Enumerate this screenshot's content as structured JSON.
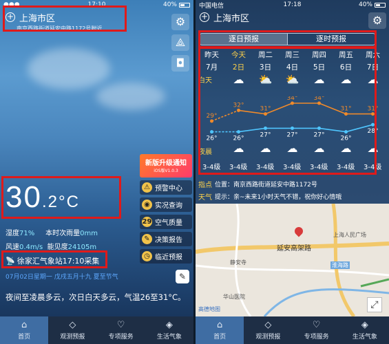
{
  "left": {
    "status": {
      "carrier": "●●●",
      "time": "17:10",
      "battery": "40%"
    },
    "location": {
      "plus_icon": "plus-circle-icon",
      "city": "上海市区",
      "address": "南京西路街道延安中路1172号附近"
    },
    "side_icons": [
      "gear-icon",
      "share-icon",
      "camera-icon"
    ],
    "temperature": {
      "int": "30",
      "decimal": ".2",
      "unit": "°C"
    },
    "banner": {
      "title": "新版升级通知",
      "version": "iOS版V1.0.3"
    },
    "menu": [
      {
        "icon": "warning-icon",
        "glyph": "⚠",
        "label": "预警中心"
      },
      {
        "icon": "live-icon",
        "glyph": "◉",
        "label": "实况查询"
      },
      {
        "icon": "aqi-icon",
        "glyph": "29",
        "label": "空气质量"
      },
      {
        "icon": "report-icon",
        "glyph": "✎",
        "label": "决策报告"
      },
      {
        "icon": "clock-icon",
        "glyph": "◷",
        "label": "临近预报"
      }
    ],
    "humidity_label": "湿度",
    "humidity": "71%",
    "rain_label": "本时次雨量",
    "rain": "0mm",
    "wind_label": "风速",
    "wind": "0.4m/s",
    "vis_label": "能见度",
    "vis": "24105m",
    "station": "徐家汇气象站17:10采集",
    "date_line": "07月02日星期一  戊戌五月十九  夏至节气",
    "forecast": "夜间至凌晨多云，次日白天多云，气温26至31°C。",
    "tabs": [
      {
        "icon": "home-icon",
        "label": "首页"
      },
      {
        "icon": "cube-icon",
        "label": "观测预报"
      },
      {
        "icon": "heart-icon",
        "label": "专项服务"
      },
      {
        "icon": "tag-icon",
        "label": "生活气象"
      }
    ]
  },
  "right": {
    "status": {
      "carrier": "中国电信",
      "time": "17:18",
      "battery": "40%"
    },
    "location": {
      "city": "上海市区"
    },
    "segments": [
      "逐日预报",
      "逐时预报"
    ],
    "days": [
      "昨天",
      "今天",
      "周二",
      "周三",
      "周四",
      "周五",
      "周六"
    ],
    "month": "7月",
    "dates": [
      "2日",
      "3日",
      "4日",
      "5日",
      "6日",
      "7日"
    ],
    "day_label": "白天",
    "night_label": "夜晨",
    "highs": [
      29,
      32,
      31,
      34,
      34,
      31,
      31
    ],
    "lows": [
      26,
      26,
      27,
      27,
      27,
      26,
      28
    ],
    "high_labels": [
      "29°",
      "32°",
      "31°",
      "34°",
      "34°",
      "31°",
      "31°"
    ],
    "low_labels": [
      "26°",
      "26°",
      "27°",
      "27°",
      "27°",
      "26°",
      "28°"
    ],
    "wind": [
      "3-4级",
      "3-4级",
      "3-4级",
      "3-4级",
      "3-4级",
      "3-4级",
      "3-4级"
    ],
    "point_tag": "指点",
    "point_text": "位置：南京西路街道延安中路1172号",
    "weather_tag": "天气",
    "weather_text": "提示：亲~未来1小时天气不错，祝你好心情哦",
    "map_labels": [
      "延安高架路",
      "静安寺",
      "上海人民广场",
      "淮海路",
      "华山医院",
      "高德地图"
    ],
    "tabs": [
      {
        "icon": "home-icon",
        "label": "首页"
      },
      {
        "icon": "cube-icon",
        "label": "观测预报"
      },
      {
        "icon": "heart-icon",
        "label": "专项服务"
      },
      {
        "icon": "tag-icon",
        "label": "生活气象"
      }
    ],
    "colors": {
      "high": "#f08a2a",
      "low": "#4fc6ff",
      "accent": "#ffd24a",
      "redbox": "#e01a1a"
    }
  }
}
